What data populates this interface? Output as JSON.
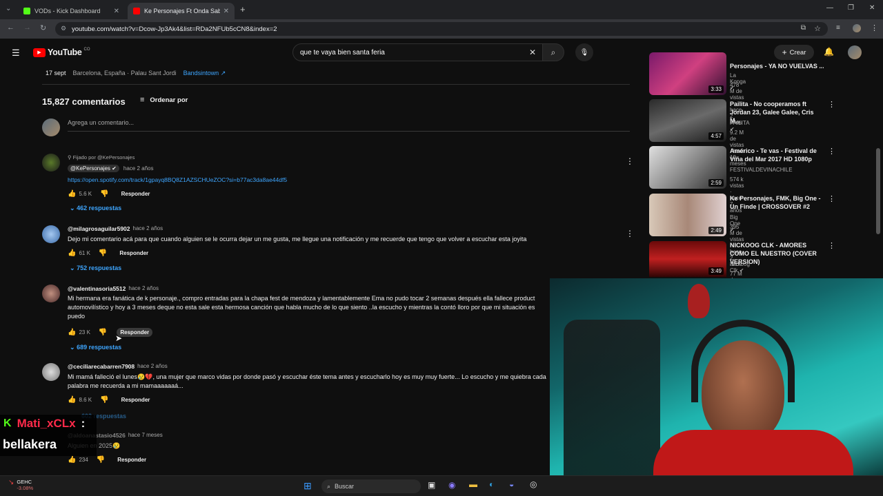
{
  "browser": {
    "tabs": [
      {
        "label": "VODs - Kick Dashboard"
      },
      {
        "label": "Ke Personajes Ft Onda Sabane"
      }
    ],
    "url": "youtube.com/watch?v=Dcow-Jp3Ak4&list=RDa2NFUb5cCN8&index=2"
  },
  "youtube": {
    "logo": "YouTube",
    "country": "CO",
    "search_value": "que te vaya bien santa feria",
    "create_label": "Crear"
  },
  "event": {
    "date": "17 sept",
    "place": "Barcelona, España · Palau Sant Jordi",
    "link": "Bandsintown"
  },
  "comments_header": {
    "count": "15,827 comentarios",
    "sort": "Ordenar por",
    "add_placeholder": "Agrega un comentario..."
  },
  "comments": [
    {
      "pinned": "Fijado por @KePersonajes",
      "author": "@KePersonajes",
      "time": "hace 2 años",
      "text": "https://open.spotify.com/track/1gpayq8BQ8Z1AZSCHUeZOC?si=b77ac3da8ae44df5",
      "likes": "5.6 K",
      "reply": "Responder",
      "replies": "462 respuestas"
    },
    {
      "author": "@milagrosaguilar5902",
      "time": "hace 2 años",
      "text": "Dejo mi comentario acá para que cuando alguien se le ocurra dejar un me gusta, me llegue una notificación y me recuerde que tengo que volver a escuchar esta joyita",
      "likes": "61 K",
      "reply": "Responder",
      "replies": "752 respuestas"
    },
    {
      "author": "@valentinasoria5512",
      "time": "hace 2 años",
      "text": "Mi hermana era fanática de k personaje., compro entradas para la chapa fest de mendoza y lamentablemente Ema no pudo tocar 2 semanas después ella fallece product automovilístico y hoy a 3 meses deque no esta sale esta hermosa canción que habla mucho de lo que siento ..la escucho y mientras la contó lloro por que mi situación es puedo",
      "likes": "23 K",
      "reply": "Responder",
      "replies": "689 respuestas"
    },
    {
      "author": "@ceciliarecabarren7908",
      "time": "hace 2 años",
      "text": "Mi mamá falleció el lunes😢💔, una mujer que marco vidas por donde pasó y escuchar éste tema antes y escucharlo hoy es muy muy fuerte... Lo escucho y me quiebra cada palabra me recuerda a mi mamaaaaaaá...",
      "likes": "8.6 K",
      "reply": "Responder",
      "replies": "602 respuestas"
    },
    {
      "author": "@aldoanastasio4526",
      "time": "hace 7 meses",
      "text": "Alguien en 2025😢",
      "likes": "234",
      "reply": "Responder"
    }
  ],
  "sidebar_videos": [
    {
      "title": "Personajes - YA NO VUELVAS ...",
      "channel": "La Konga",
      "meta": "478 M de vistas · hace 2 años",
      "duration": "3:33"
    },
    {
      "title": "Pailita - No cooperamos ft Jordan 23, Galee Galee, Cris M...",
      "channel": "PAILITA",
      "meta": "9.2 M de vistas · hace 10 meses",
      "duration": "4:57"
    },
    {
      "title": "Américo - Te vas - Festival de Viña del Mar 2017 HD 1080p",
      "channel": "FESTIVALDEVINACHILE",
      "meta": "574 k vistas · hace 7 años",
      "duration": "2:59"
    },
    {
      "title": "Ke Personajes, FMK, Big One - Un Finde | CROSSOVER #2",
      "channel": "Big One",
      "meta": "395 M de vistas · hace 2 años",
      "duration": "2:49"
    },
    {
      "title": "NICKOOG CLK - AMORES COMO EL NUESTRO (COVER VERSION)",
      "channel": "Nickoog Clk",
      "meta": "77 M de vistas · hace 1 año",
      "duration": "3:49"
    }
  ],
  "overlay": {
    "chat_user": "Mati_xCLx",
    "chat_message": "bellakera"
  },
  "taskbar": {
    "stock": "GEHC",
    "stock_change": "-3.08%",
    "search": "Buscar"
  }
}
